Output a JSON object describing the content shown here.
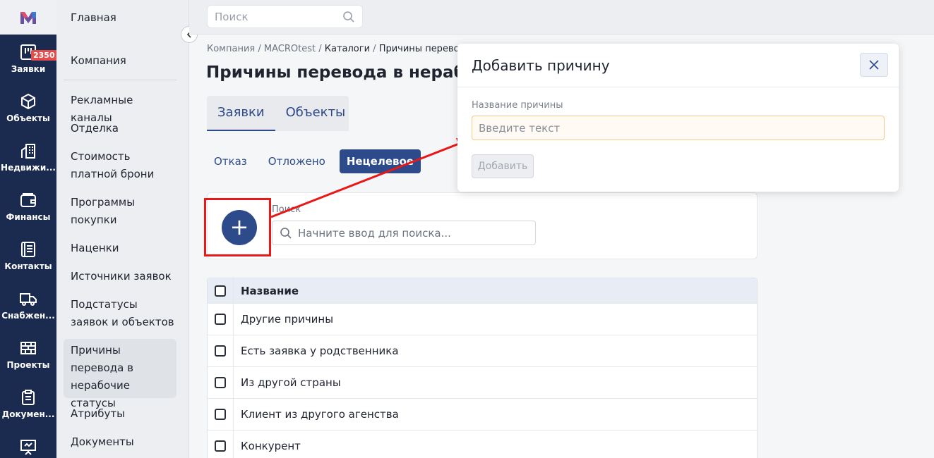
{
  "rail": {
    "items": [
      {
        "label": "Заявки",
        "icon": "bar-chart-icon",
        "badge": "2350"
      },
      {
        "label": "Объекты",
        "icon": "cube-icon"
      },
      {
        "label": "Недвижи...",
        "icon": "building-icon"
      },
      {
        "label": "Финансы",
        "icon": "wallet-icon"
      },
      {
        "label": "Контакты",
        "icon": "contacts-icon"
      },
      {
        "label": "Снабжен...",
        "icon": "truck-icon"
      },
      {
        "label": "Проекты",
        "icon": "bricks-icon"
      },
      {
        "label": "Докумен...",
        "icon": "clipboard-icon"
      },
      {
        "label": "",
        "icon": "presentation-icon"
      }
    ]
  },
  "sidebar": {
    "header": "Главная",
    "items": [
      "Компания",
      "Рекламные каналы",
      "Отделка",
      "Стоимость платной брони",
      "Программы покупки",
      "Наценки",
      "Источники заявок",
      "Подстатусы заявок и объектов",
      "Причины перевода в нерабочие статусы",
      "Атрибуты",
      "Документы"
    ]
  },
  "topbar": {
    "search_placeholder": "Поиск"
  },
  "breadcrumb": {
    "a": "Компания",
    "b": "MACROtest",
    "c": "Каталоги",
    "d": "Причины перевода в"
  },
  "page": {
    "title": "Причины перевода в нерабоч"
  },
  "tabs": [
    "Заявки",
    "Объекты"
  ],
  "subtabs": [
    "Отказ",
    "Отложено",
    "Нецелевое"
  ],
  "filter": {
    "label": "Поиск",
    "placeholder": "Начните ввод для поиска..."
  },
  "table": {
    "header": "Название",
    "rows": [
      "Другие причины",
      "Есть заявка у родственника",
      "Из другой страны",
      "Клиент из другого агенства",
      "Конкурент"
    ]
  },
  "modal": {
    "title": "Добавить причину",
    "field_label": "Название причины",
    "placeholder": "Введите текст",
    "submit": "Добавить"
  },
  "colors": {
    "primary": "#2d4a8a",
    "rail": "#1b2a4f",
    "annotation": "#e81818",
    "badge": "#e14c4c"
  }
}
